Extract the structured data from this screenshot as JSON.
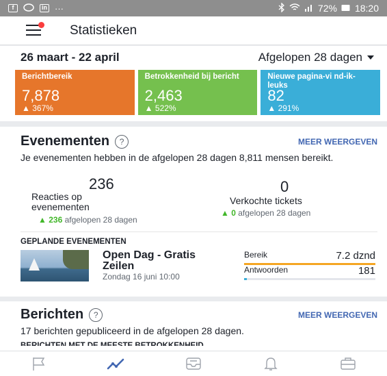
{
  "statusbar": {
    "left_icons": [
      "facebook-icon",
      "chat-icon",
      "linkedin-icon",
      "more-icon"
    ],
    "linkedin_glyph": "in",
    "facebook_glyph": "f",
    "more_glyph": "···",
    "battery": "72%",
    "time": "18:20"
  },
  "header": {
    "title": "Statistieken"
  },
  "summary": {
    "date_range": "26 maart - 22 april",
    "period": "Afgelopen 28 dagen",
    "tiles": [
      {
        "label": "Berichtbereik",
        "value": "7,878",
        "delta": "367%",
        "color": "#e6762b"
      },
      {
        "label": "Betrokkenheid bij bericht",
        "value": "2,463",
        "delta": "522%",
        "color": "#75c04e"
      },
      {
        "label": "Nieuwe pagina-vi nd-ik-leuks",
        "value": "82",
        "delta": "291%",
        "color": "#3aaed8"
      }
    ]
  },
  "events": {
    "heading": "Evenementen",
    "more": "MEER WEERGEVEN",
    "description": "Je evenementen hebben in de afgelopen 28 dagen 8,811 mensen bereikt.",
    "reactions": {
      "value": "236",
      "label": "Reacties op evenementen",
      "sub_value": "236",
      "sub_text": "afgelopen 28 dagen"
    },
    "tickets": {
      "value": "0",
      "label": "Verkochte tickets",
      "sub_value": "0",
      "sub_text": "afgelopen 28 dagen"
    },
    "planned_heading": "GEPLANDE EVENEMENTEN",
    "event": {
      "title": "Open Dag - Gratis Zeilen",
      "date": "Zondag 16 juni 10:00",
      "reach_label": "Bereik",
      "reach_value": "7.2 dznd",
      "reach_fill": 1.0,
      "answers_label": "Antwoorden",
      "answers_value": "181",
      "answers_fill": 0.02
    }
  },
  "posts": {
    "heading": "Berichten",
    "more": "MEER WEERGEVEN",
    "description": "17 berichten gepubliceerd in de afgelopen 28 dagen.",
    "subheading": "BERICHTEN MET DE MEESTE BETROKKENHEID"
  },
  "tabbar": {
    "tabs": [
      "flag-icon",
      "insights-icon",
      "inbox-icon",
      "bell-icon",
      "briefcase-icon"
    ],
    "active": "insights-icon",
    "accent": "#4267b2"
  }
}
